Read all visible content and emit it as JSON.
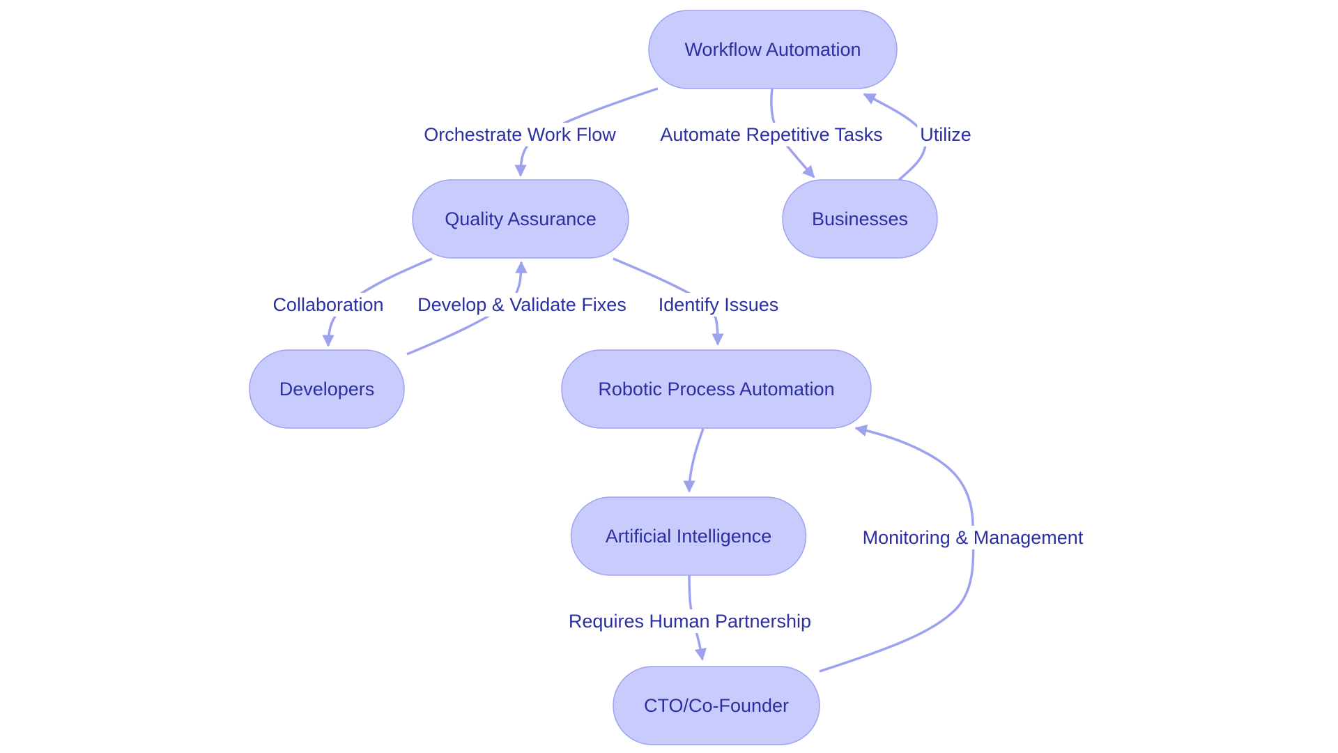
{
  "diagram": {
    "type": "flowchart",
    "colors": {
      "node_fill": "#c8cbfb",
      "node_stroke": "#9da2ef",
      "edge": "#9da2ef",
      "text": "#2b2fa0",
      "background": "#ffffff"
    },
    "nodes": [
      {
        "id": "workflow",
        "label": "Workflow Automation"
      },
      {
        "id": "qa",
        "label": "Quality Assurance"
      },
      {
        "id": "businesses",
        "label": "Businesses"
      },
      {
        "id": "developers",
        "label": "Developers"
      },
      {
        "id": "rpa",
        "label": "Robotic Process Automation"
      },
      {
        "id": "ai",
        "label": "Artificial Intelligence"
      },
      {
        "id": "cto",
        "label": "CTO/Co-Founder"
      }
    ],
    "edges": [
      {
        "from": "workflow",
        "to": "qa",
        "label": "Orchestrate Work Flow"
      },
      {
        "from": "workflow",
        "to": "businesses",
        "label": "Automate Repetitive Tasks"
      },
      {
        "from": "businesses",
        "to": "workflow",
        "label": "Utilize"
      },
      {
        "from": "qa",
        "to": "developers",
        "label": "Collaboration"
      },
      {
        "from": "developers",
        "to": "qa",
        "label": "Develop & Validate Fixes"
      },
      {
        "from": "qa",
        "to": "rpa",
        "label": "Identify Issues"
      },
      {
        "from": "rpa",
        "to": "ai",
        "label": ""
      },
      {
        "from": "ai",
        "to": "cto",
        "label": "Requires Human Partnership"
      },
      {
        "from": "cto",
        "to": "rpa",
        "label": "Monitoring & Management"
      }
    ]
  }
}
